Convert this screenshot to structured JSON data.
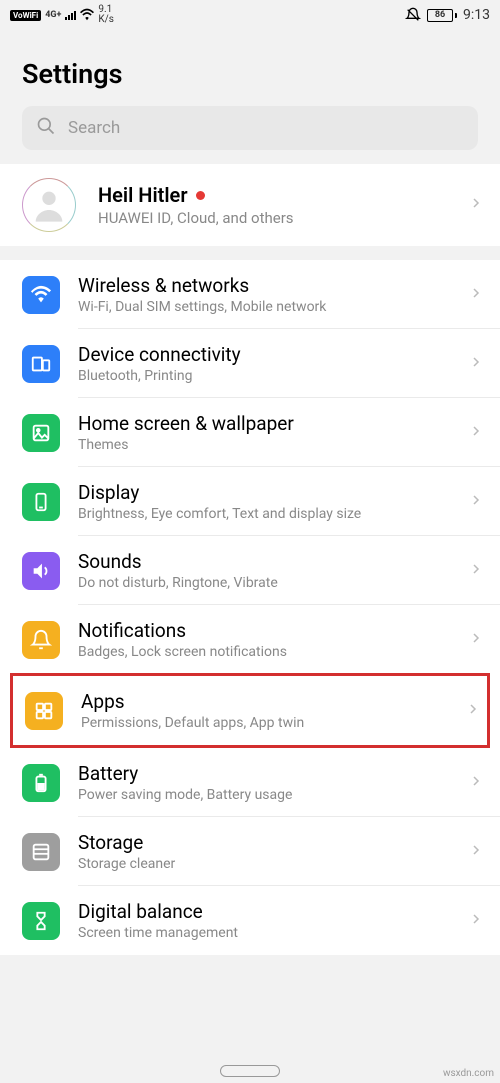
{
  "status": {
    "vowifi": "VoWiFi",
    "network_gen": "4G+",
    "speed_top": "9.1",
    "speed_bot": "K/s",
    "battery": "86",
    "time": "9:13"
  },
  "page_title": "Settings",
  "search": {
    "placeholder": "Search"
  },
  "profile": {
    "name": "Heil Hitler",
    "sub": "HUAWEI ID, Cloud, and others"
  },
  "rows": {
    "wireless": {
      "title": "Wireless & networks",
      "sub": "Wi-Fi, Dual SIM settings, Mobile network",
      "color": "#2d7ff9"
    },
    "device": {
      "title": "Device connectivity",
      "sub": "Bluetooth, Printing",
      "color": "#2d7ff9"
    },
    "home": {
      "title": "Home screen & wallpaper",
      "sub": "Themes",
      "color": "#1fbf62"
    },
    "display": {
      "title": "Display",
      "sub": "Brightness, Eye comfort, Text and display size",
      "color": "#1fbf62"
    },
    "sounds": {
      "title": "Sounds",
      "sub": "Do not disturb, Ringtone, Vibrate",
      "color": "#8a5cf0"
    },
    "notifications": {
      "title": "Notifications",
      "sub": "Badges, Lock screen notifications",
      "color": "#f5b020"
    },
    "apps": {
      "title": "Apps",
      "sub": "Permissions, Default apps, App twin",
      "color": "#f5b020"
    },
    "battery": {
      "title": "Battery",
      "sub": "Power saving mode, Battery usage",
      "color": "#1fbf62"
    },
    "storage": {
      "title": "Storage",
      "sub": "Storage cleaner",
      "color": "#9e9e9e"
    },
    "digital": {
      "title": "Digital balance",
      "sub": "Screen time management",
      "color": "#1fbf62"
    }
  },
  "watermark": "wsxdn.com"
}
